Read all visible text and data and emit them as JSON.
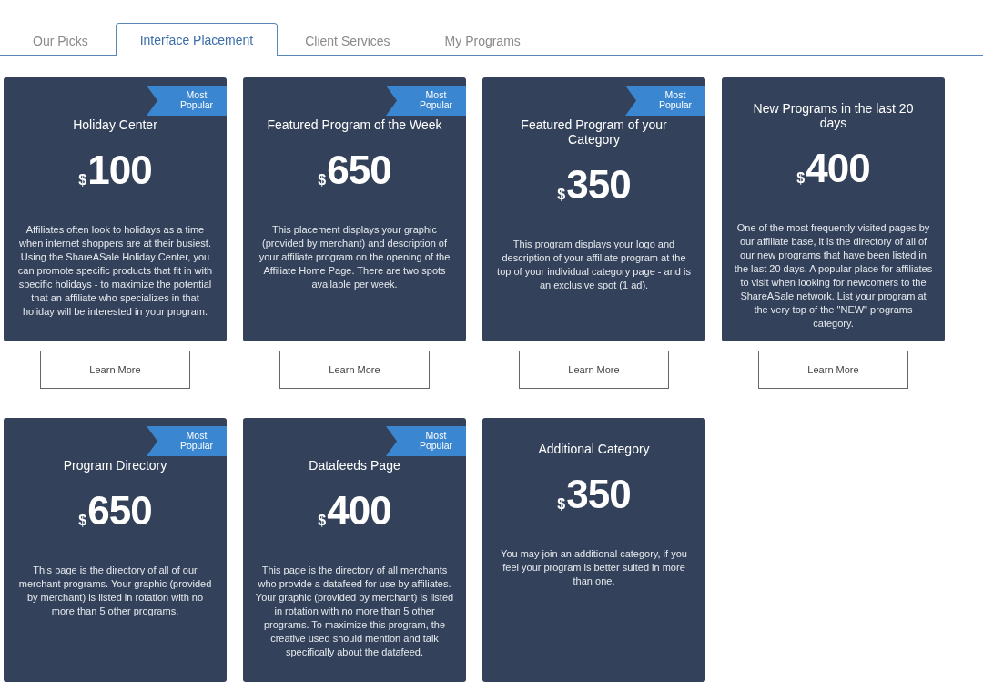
{
  "tabs": [
    {
      "label": "Our Picks",
      "selected": false
    },
    {
      "label": "Interface Placement",
      "selected": true
    },
    {
      "label": "Client Services",
      "selected": false
    },
    {
      "label": "My Programs",
      "selected": false
    }
  ],
  "rows": [
    {
      "cards": [
        {
          "ribbon": "Most Popular",
          "title": "Holiday Center",
          "currency": "$",
          "price": "100",
          "description": "Affiliates often look to holidays as a time when internet shoppers are at their busiest. Using the ShareASale Holiday Center, you can promote specific products that fit in with specific holidays - to maximize the potential that an affiliate who specializes in that holiday will be interested in your program.",
          "button": "Learn More"
        },
        {
          "ribbon": "Most Popular",
          "title": "Featured Program of the Week",
          "currency": "$",
          "price": "650",
          "description": "This placement displays your graphic (provided by merchant) and description of your affiliate program on the opening of the Affiliate Home Page. There are two spots available per week.",
          "button": "Learn More"
        },
        {
          "ribbon": "Most Popular",
          "title": "Featured Program of your Category",
          "currency": "$",
          "price": "350",
          "description": "This program displays your logo and description of your affiliate program at the top of your individual category page - and is an exclusive spot (1 ad).",
          "button": "Learn More"
        },
        {
          "title": "New Programs in the last 20 days",
          "currency": "$",
          "price": "400",
          "description": "One of the most frequently visited pages by our affiliate base, it is the directory of all of our new programs that have been listed in the last 20 days. A popular place for affiliates to visit when looking for newcomers to the ShareASale network. List your program at the very top of the \"NEW\" programs category.",
          "button": "Learn More"
        }
      ]
    },
    {
      "cards": [
        {
          "ribbon": "Most Popular",
          "title": "Program Directory",
          "currency": "$",
          "price": "650",
          "description": "This page is the directory of all of our merchant programs. Your graphic (provided by merchant) is listed in rotation with no more than 5 other programs."
        },
        {
          "ribbon": "Most Popular",
          "title": "Datafeeds Page",
          "currency": "$",
          "price": "400",
          "description": "This page is the directory of all merchants who provide a datafeed for use by affiliates. Your graphic (provided by merchant) is listed in rotation with no more than 5 other programs. To maximize this program, the creative used should mention and talk specifically about the datafeed."
        },
        {
          "title": "Additional Category",
          "currency": "$",
          "price": "350",
          "description": "You may join an additional category, if you feel your program is better suited in more than one."
        }
      ]
    }
  ]
}
